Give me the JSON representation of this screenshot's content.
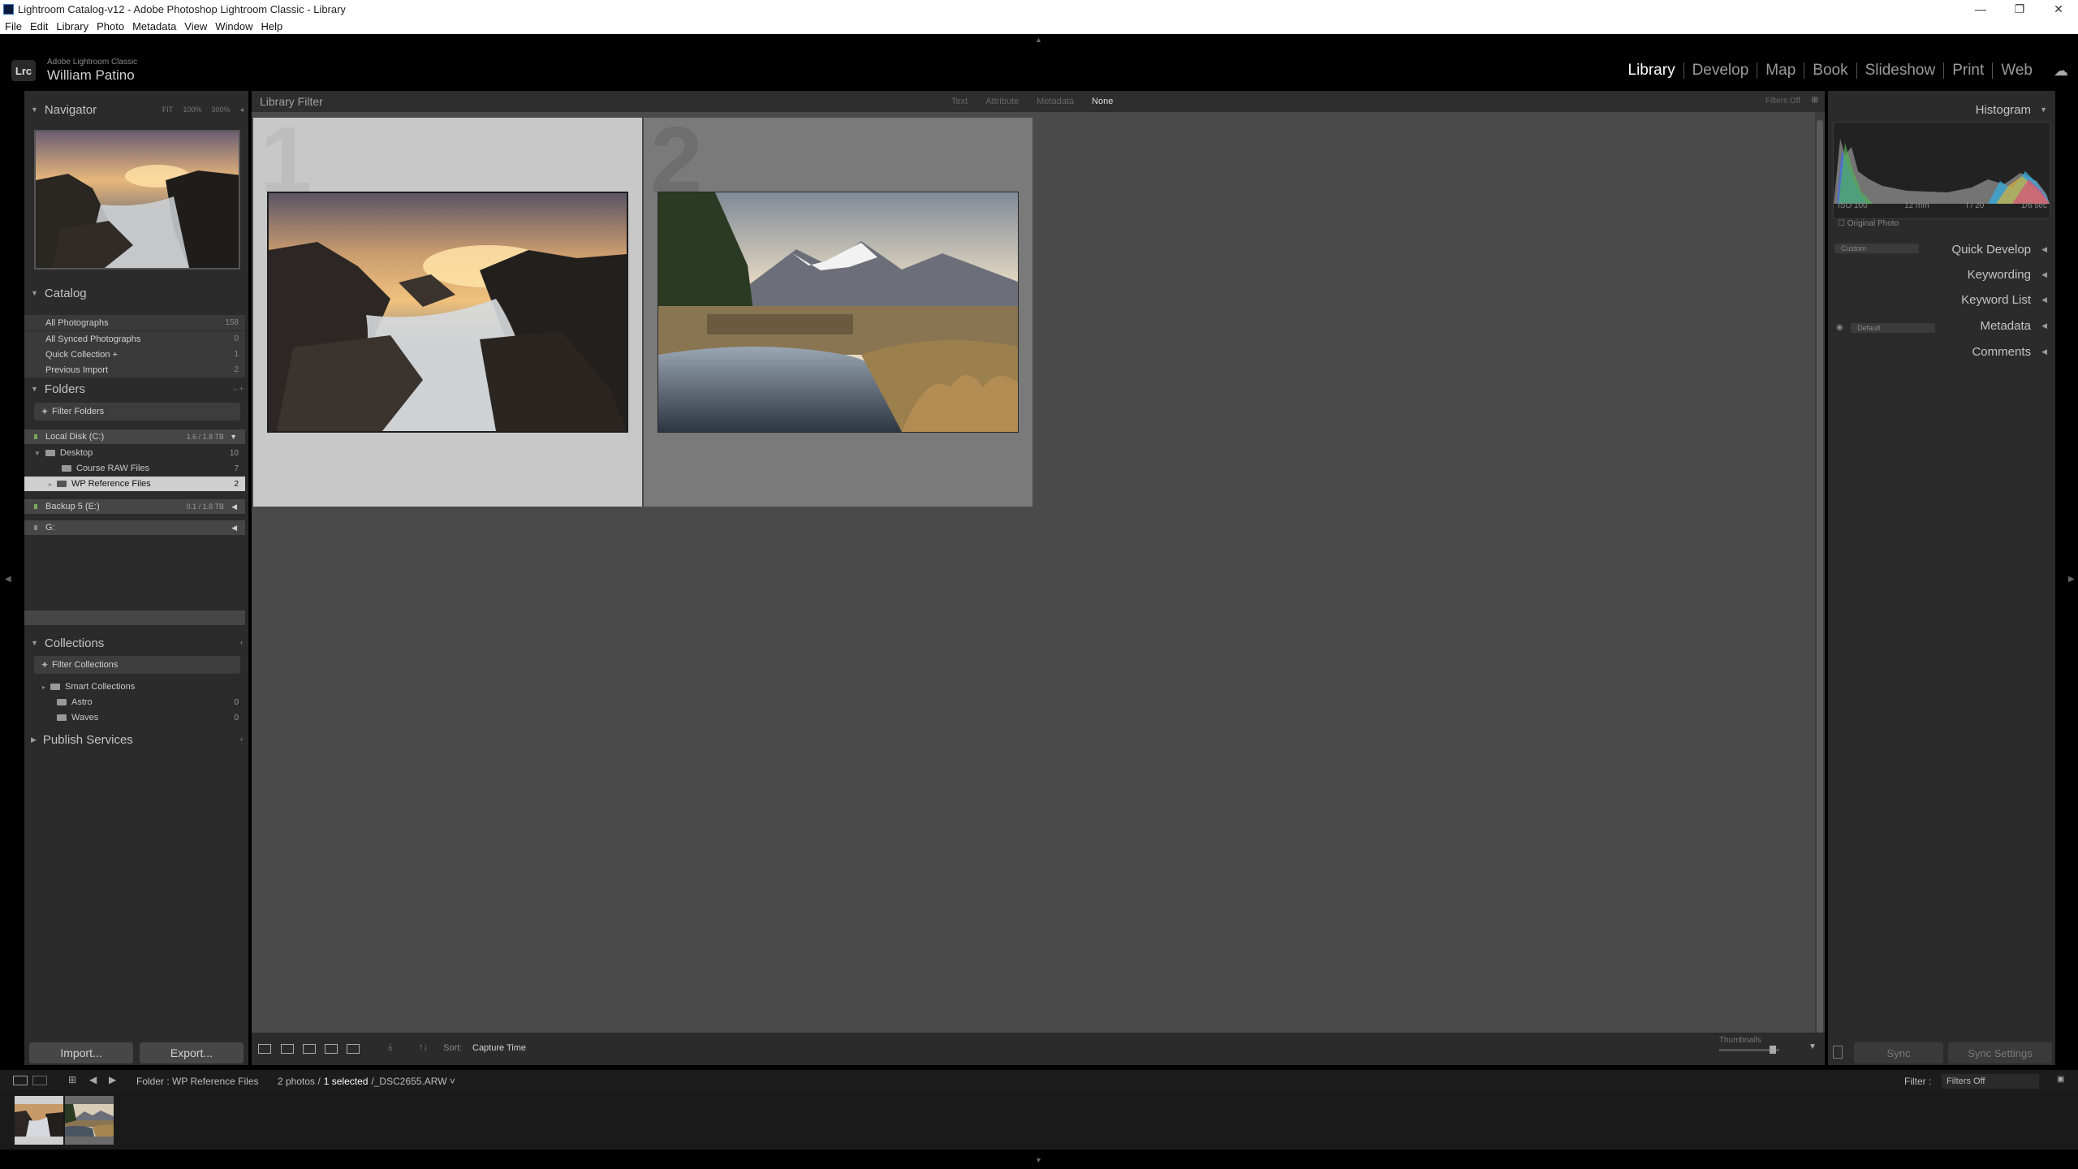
{
  "window": {
    "title": "Lightroom Catalog-v12 - Adobe Photoshop Lightroom Classic - Library",
    "controls": [
      "—",
      "❐",
      "✕"
    ]
  },
  "menu": [
    "File",
    "Edit",
    "Library",
    "Photo",
    "Metadata",
    "View",
    "Window",
    "Help"
  ],
  "identity": {
    "logo": "Lrc",
    "product": "Adobe Lightroom Classic",
    "user": "William Patino"
  },
  "modules": [
    "Library",
    "Develop",
    "Map",
    "Book",
    "Slideshow",
    "Print",
    "Web"
  ],
  "active_module": "Library",
  "navigator": {
    "title": "Navigator",
    "options": [
      "FIT",
      "100%",
      "300%"
    ]
  },
  "catalog": {
    "title": "Catalog",
    "items": [
      {
        "label": "All Photographs",
        "count": "158"
      },
      {
        "label": "All Synced Photographs",
        "count": "0"
      },
      {
        "label": "Quick Collection +",
        "count": "1"
      },
      {
        "label": "Previous Import",
        "count": "2"
      }
    ]
  },
  "folders": {
    "title": "Folders",
    "actions": "– +",
    "filter": "Filter Folders",
    "volumes": [
      {
        "name": "Local Disk (C:)",
        "info": "1.6 / 1.8 TB"
      },
      {
        "name": "Backup 5 (E:)",
        "info": "0.1 / 1.8 TB"
      },
      {
        "name": "G:",
        "info": ""
      }
    ],
    "items": [
      {
        "label": "Desktop",
        "count": "10"
      },
      {
        "label": "Course RAW Files",
        "count": "7"
      },
      {
        "label": "WP Reference Files",
        "count": "2"
      }
    ]
  },
  "collections": {
    "title": "Collections",
    "filter": "Filter Collections",
    "items": [
      {
        "label": "Smart Collections",
        "count": ""
      },
      {
        "label": "Astro",
        "count": "0"
      },
      {
        "label": "Waves",
        "count": "0"
      }
    ]
  },
  "publish": {
    "title": "Publish Services"
  },
  "buttons": {
    "import": "Import...",
    "export": "Export..."
  },
  "library_filter": {
    "title": "Library Filter",
    "tabs": [
      "Text",
      "Attribute",
      "Metadata",
      "None"
    ],
    "status": "Filters Off"
  },
  "grid": {
    "cells": [
      {
        "index": "1",
        "selected": true
      },
      {
        "index": "2",
        "selected": false
      }
    ]
  },
  "toolbar": {
    "sort_label": "Sort:",
    "sort_value": "Capture Time",
    "thumbnails_label": "Thumbnails"
  },
  "histogram": {
    "title": "Histogram",
    "iso": "ISO 100",
    "focal": "12 mm",
    "aperture": "f / 20",
    "shutter": "1/6 sec",
    "original": "Original Photo"
  },
  "right_panels": {
    "quick_develop": "Quick Develop",
    "quick_develop_preset": "Custom",
    "keywording": "Keywording",
    "keyword_list": "Keyword List",
    "metadata": "Metadata",
    "metadata_preset": "Default",
    "comments": "Comments"
  },
  "sync": {
    "sync": "Sync",
    "sync_settings": "Sync Settings"
  },
  "filmstrip": {
    "source": "Folder : WP Reference Files",
    "count_prefix": "2 photos /",
    "count_selected": "1 selected",
    "filename": "/_DSC2655.ARW ˅",
    "filter_label": "Filter :",
    "filter_value": "Filters Off"
  },
  "colors": {
    "panel_bg": "#2b2b2b",
    "grid_bg": "#4a4a4a",
    "cell_selected": "#c8c8c8",
    "cell_normal": "#7a7a7a",
    "active_text": "#ffffff"
  }
}
